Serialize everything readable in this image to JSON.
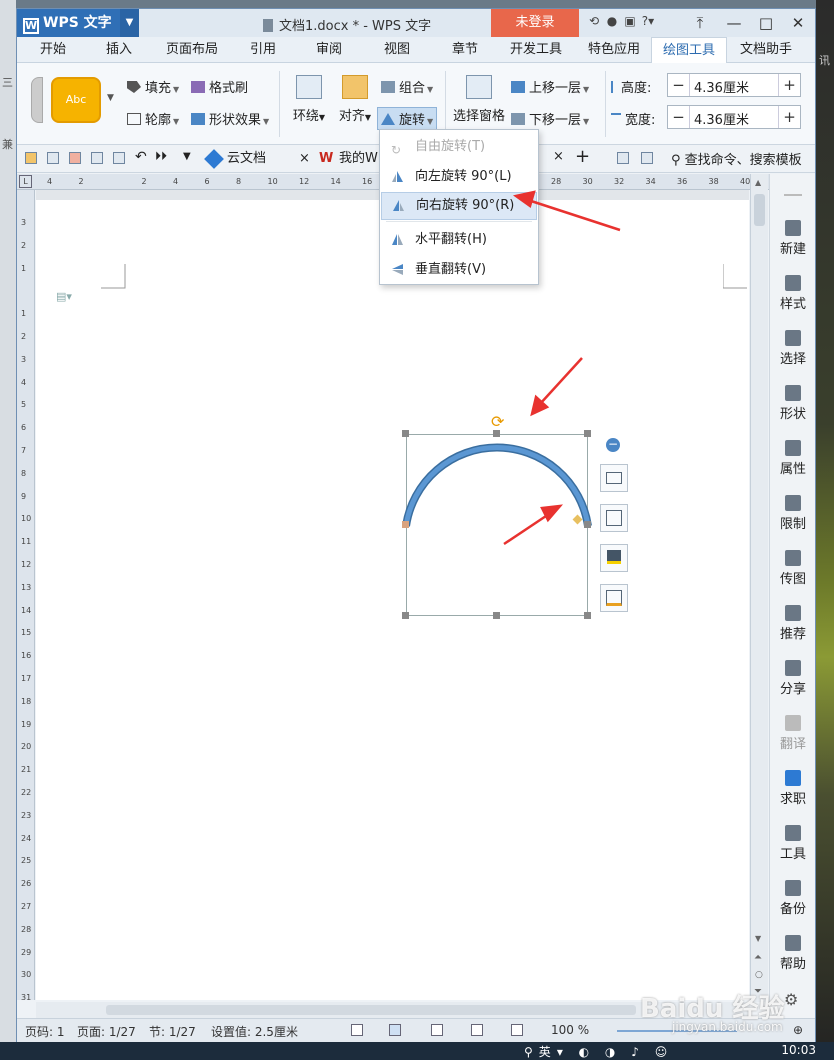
{
  "window": {
    "app_name": "WPS 文字",
    "doc_title": "文档1.docx * - WPS 文字",
    "login_label": "未登录"
  },
  "menubar": [
    "开始",
    "插入",
    "页面布局",
    "引用",
    "审阅",
    "视图",
    "章节",
    "开发工具",
    "特色应用",
    "绘图工具",
    "文档助手"
  ],
  "menubar_active": "绘图工具",
  "ribbon": {
    "shape_style_text": "Abc",
    "fill": "填充",
    "format_painter": "格式刷",
    "outline": "轮廓",
    "shape_effect": "形状效果",
    "wrap": "环绕",
    "align": "对齐",
    "group": "组合",
    "rotate": "旋转",
    "selection_pane": "选择窗格",
    "bring_forward": "上移一层",
    "send_backward": "下移一层",
    "height_label": "高度:",
    "height_value": "4.36厘米",
    "width_label": "宽度:",
    "width_value": "4.36厘米",
    "minus": "−",
    "plus": "+"
  },
  "quickbar": {
    "tab_cloud": "云文档",
    "tab_mine": "我的W",
    "search": "查找命令、搜索模板",
    "close": "×",
    "add": "+"
  },
  "rotate_menu": {
    "items": [
      {
        "label": "自由旋转(T)",
        "state": "disabled"
      },
      {
        "label": "向左旋转 90°(L)",
        "state": "normal"
      },
      {
        "label": "向右旋转 90°(R)",
        "state": "hover"
      },
      {
        "label": "水平翻转(H)",
        "state": "normal"
      },
      {
        "label": "垂直翻转(V)",
        "state": "normal"
      }
    ]
  },
  "ruler_h": [
    "4",
    "2",
    "",
    "2",
    "4",
    "6",
    "8",
    "10",
    "12",
    "14",
    "16",
    "18",
    "20",
    "22",
    "24",
    "26",
    "28",
    "30",
    "32",
    "34",
    "36",
    "38",
    "40"
  ],
  "ruler_v": [
    "3",
    "2",
    "1",
    "",
    "1",
    "2",
    "3",
    "4",
    "5",
    "6",
    "7",
    "8",
    "9",
    "10",
    "11",
    "12",
    "13",
    "14",
    "15",
    "16",
    "17",
    "18",
    "19",
    "20",
    "21",
    "22",
    "23",
    "24",
    "25",
    "26",
    "27",
    "28",
    "29",
    "30",
    "31"
  ],
  "sidepanel": [
    {
      "label": "新建"
    },
    {
      "label": "样式"
    },
    {
      "label": "选择"
    },
    {
      "label": "形状"
    },
    {
      "label": "属性"
    },
    {
      "label": "限制"
    },
    {
      "label": "传图"
    },
    {
      "label": "推荐"
    },
    {
      "label": "分享"
    },
    {
      "label": "翻译"
    },
    {
      "label": "求职"
    },
    {
      "label": "工具"
    },
    {
      "label": "备份"
    },
    {
      "label": "帮助"
    }
  ],
  "statusbar": {
    "page_num": "页码: 1",
    "page_count": "页面: 1/27",
    "section": "节: 1/27",
    "setting": "设置值: 2.5厘米",
    "zoom": "100 %"
  },
  "taskbar": {
    "time": "10:03",
    "ime": "英"
  },
  "desktop_left": {
    "items": [
      "三",
      "兼"
    ]
  },
  "desktop_right": {
    "items": [
      "讯"
    ]
  },
  "watermark": {
    "main": "Baidu 经验",
    "sub": "jingyan.baidu.com"
  },
  "colors": {
    "accent": "#2f6fb6",
    "login": "#e8674b",
    "arc": "#4a86c5",
    "arrow": "#e8322f",
    "rotate_handle": "#e89a00"
  }
}
